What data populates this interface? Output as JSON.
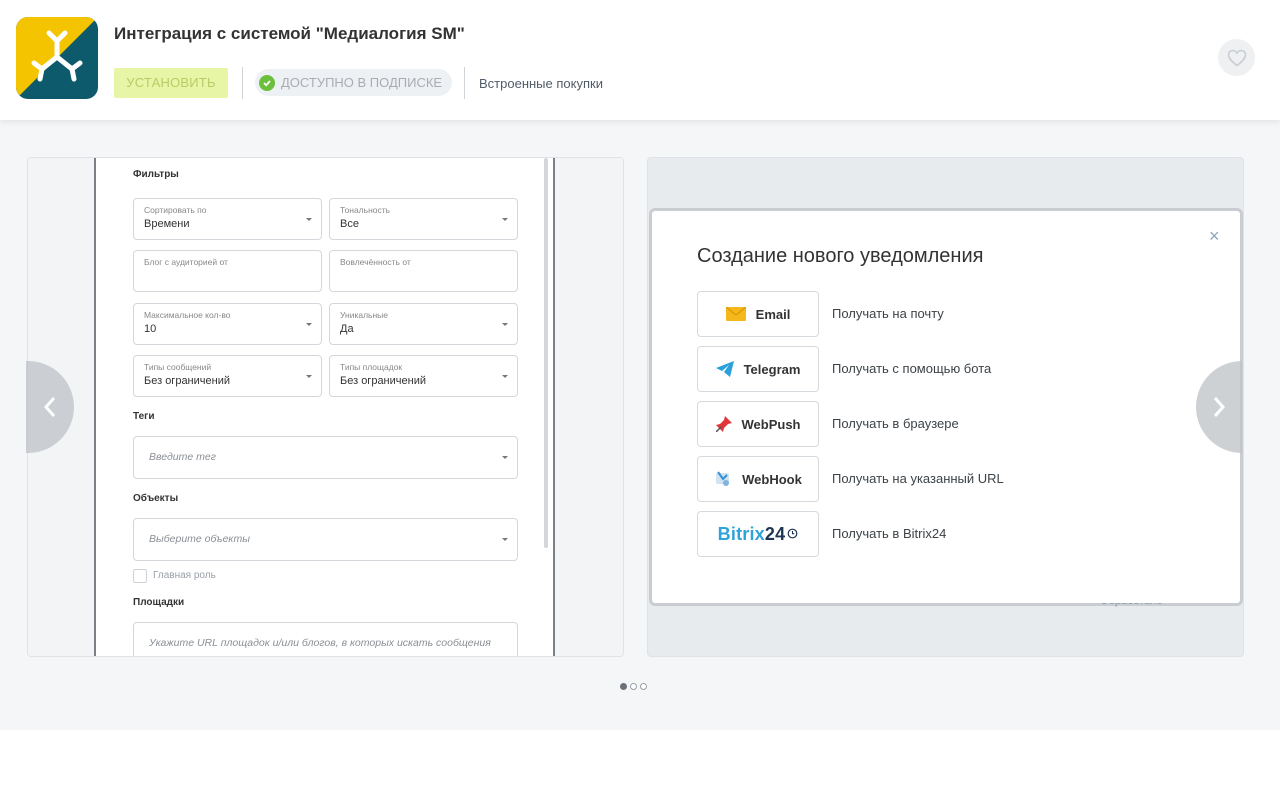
{
  "app": {
    "title": "Интеграция с системой \"Медиалогия SM\"",
    "install_label": "УСТАНОВИТЬ",
    "subscription_label": "ДОСТУПНО В ПОДПИСКЕ",
    "purchases_label": "Встроенные покупки",
    "colors": {
      "icon_yellow": "#f5c400",
      "icon_teal": "#0c5a6b",
      "install_bg": "#e6f5a6",
      "check_green": "#6bbf3c"
    }
  },
  "slide1": {
    "filters_title": "Фильтры",
    "fields": [
      {
        "label": "Сортировать по",
        "value": "Времени"
      },
      {
        "label": "Тональность",
        "value": "Все"
      },
      {
        "label": "Блог с аудиторией от",
        "value": ""
      },
      {
        "label": "Вовлечённость от",
        "value": ""
      },
      {
        "label": "Максимальное кол-во",
        "value": "10"
      },
      {
        "label": "Уникальные",
        "value": "Да"
      },
      {
        "label": "Типы сообщений",
        "value": "Без ограничений"
      },
      {
        "label": "Типы площадок",
        "value": "Без ограничений"
      }
    ],
    "tags_title": "Теги",
    "tags_placeholder": "Введите тег",
    "objects_title": "Объекты",
    "objects_placeholder": "Выберите объекты",
    "main_role_label": "Главная роль",
    "platforms_title": "Площадки",
    "platforms_placeholder": "Укажите URL площадок и/или блогов, в которых искать сообщения"
  },
  "slide2": {
    "modal_title": "Создание нового уведомления",
    "close_symbol": "×",
    "channels": [
      {
        "name": "Email",
        "icon": "envelope-icon",
        "desc": "Получать на почту"
      },
      {
        "name": "Telegram",
        "icon": "telegram-icon",
        "desc": "Получать с помощью бота"
      },
      {
        "name": "WebPush",
        "icon": "pin-icon",
        "desc": "Получать в браузере"
      },
      {
        "name": "WebHook",
        "icon": "webhook-icon",
        "desc": "Получать на указанный URL"
      },
      {
        "name": "Bitrix24",
        "icon": "bitrix24-logo",
        "desc": "Получать в Bitrix24"
      }
    ],
    "bitrix_logo": {
      "part1": "Bitrix",
      "part2": "24"
    },
    "behind_text": "Обработано"
  },
  "carousel": {
    "slides_total": 3,
    "active_index": 0
  }
}
